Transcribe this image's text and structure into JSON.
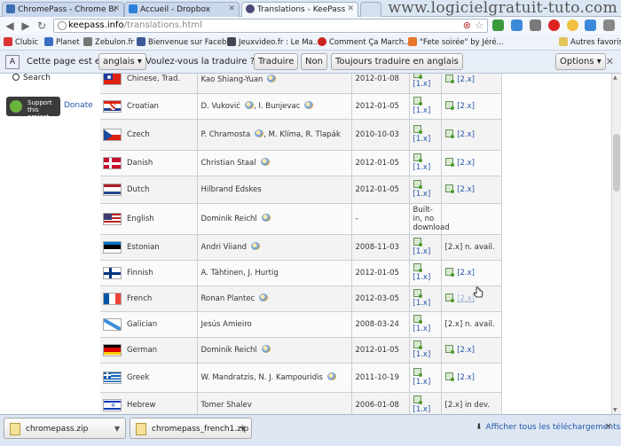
{
  "tabs": [
    {
      "label": "ChromePass - Chrome Br",
      "color": "#3c6fb3",
      "active": false
    },
    {
      "label": "Accueil - Dropbox",
      "color": "#2f7fd6",
      "active": false
    },
    {
      "label": "Translations - KeePass",
      "color": "#4a4a7a",
      "active": true
    }
  ],
  "watermark": "www.logicielgratuit-tuto.com",
  "address": {
    "host": "keepass.info",
    "path": "/translations.html"
  },
  "bookmarks": [
    {
      "label": "Clubic",
      "color": "#d33"
    },
    {
      "label": "Planet",
      "color": "#3a6fc4"
    },
    {
      "label": "Zebulon.fr",
      "color": "#777"
    },
    {
      "label": "Bienvenue sur Faceb...",
      "color": "#3b5998"
    },
    {
      "label": "Jeuxvideo.fr : Le Ma...",
      "color": "#445"
    },
    {
      "label": "Comment Ça March...",
      "color": "#c22"
    },
    {
      "label": "\"Fete soirée\" by Jéré...",
      "color": "#e8762b"
    }
  ],
  "other_bookmarks": "Autres favoris",
  "translate_bar": {
    "prefix": "Cette page est en",
    "language": "anglais",
    "question": "Voulez-vous la traduire ?",
    "translate_btn": "Traduire",
    "no_btn": "Non",
    "always_btn": "Toujours traduire en anglais",
    "options_btn": "Options"
  },
  "sidebar": {
    "search_label": "Search",
    "support_label": "Support this project",
    "donate_label": "Donate"
  },
  "rows": [
    {
      "lang": "Chinese, Trad.",
      "flag": "tw",
      "author": "Kao Shiang-Yuan",
      "mail": true,
      "date": "2012-01-08",
      "v1": "[1.x]",
      "v2": "[2.x]",
      "v2dl": true
    },
    {
      "lang": "Croatian",
      "flag": "hr",
      "author": "D. Vuković",
      "author2": ", I. Bunjevac",
      "mail": true,
      "mail2": true,
      "date": "2012-01-05",
      "v1": "[1.x]",
      "v2": "[2.x]",
      "v2dl": true
    },
    {
      "lang": "Czech",
      "flag": "cz",
      "author": "P. Chramosta",
      "author2": ", M. Klíma, R. Tlapák",
      "mail": true,
      "date": "2010-10-03",
      "v1": "[1.x]",
      "v2": "[2.x]",
      "v2dl": true
    },
    {
      "lang": "Danish",
      "flag": "dk",
      "author": "Christian Staal",
      "mail": true,
      "date": "2012-01-05",
      "v1": "[1.x]",
      "v2": "[2.x]",
      "v2dl": true
    },
    {
      "lang": "Dutch",
      "flag": "nl",
      "author": "Hilbrand Edskes",
      "mail": false,
      "date": "2012-01-05",
      "v1": "[1.x]",
      "v2": "[2.x]",
      "v2dl": true
    },
    {
      "lang": "English",
      "flag": "us",
      "author": "Dominik Reichl",
      "mail": true,
      "date": "-",
      "v1": "Built-in, no download",
      "v1text": true,
      "v2": "",
      "v2dl": false
    },
    {
      "lang": "Estonian",
      "flag": "ee",
      "author": "Andri Viiand",
      "mail": true,
      "date": "2008-11-03",
      "v1": "[1.x]",
      "v2": "[2.x] n. avail.",
      "v2dl": false,
      "v2text": true
    },
    {
      "lang": "Finnish",
      "flag": "fi",
      "author": "A. Tähtinen, J. Hurtig",
      "mail": false,
      "date": "2012-01-05",
      "v1": "[1.x]",
      "v2": "[2.x]",
      "v2dl": true
    },
    {
      "lang": "French",
      "flag": "fr",
      "author": "Ronan Plantec",
      "mail": true,
      "date": "2012-03-05",
      "v1": "[1.x]",
      "v2": "[2.x]",
      "v2dl": true,
      "v2faded": true
    },
    {
      "lang": "Galician",
      "flag": "gl",
      "author": "Jesús Amieiro",
      "mail": false,
      "date": "2008-03-24",
      "v1": "[1.x]",
      "v2": "[2.x] n. avail.",
      "v2dl": false,
      "v2text": true
    },
    {
      "lang": "German",
      "flag": "de",
      "author": "Dominik Reichl",
      "mail": true,
      "date": "2012-01-05",
      "v1": "[1.x]",
      "v2": "[2.x]",
      "v2dl": true
    },
    {
      "lang": "Greek",
      "flag": "gr",
      "author": "W. Mandratzis, N. J. Kampouridis",
      "mail": true,
      "date": "2011-10-19",
      "v1": "[1.x]",
      "v2": "[2.x]",
      "v2dl": true
    },
    {
      "lang": "Hebrew",
      "flag": "il",
      "author": "Tomer Shalev",
      "mail": false,
      "date": "2006-01-08",
      "v1": "[1.x]",
      "v2": "[2.x] in dev.",
      "v2dl": false,
      "v2text": true
    }
  ],
  "downloads": [
    {
      "file": "chromepass.zip"
    },
    {
      "file": "chromepass_french1.zip"
    }
  ],
  "show_all_downloads": "Afficher tous les téléchargements..."
}
